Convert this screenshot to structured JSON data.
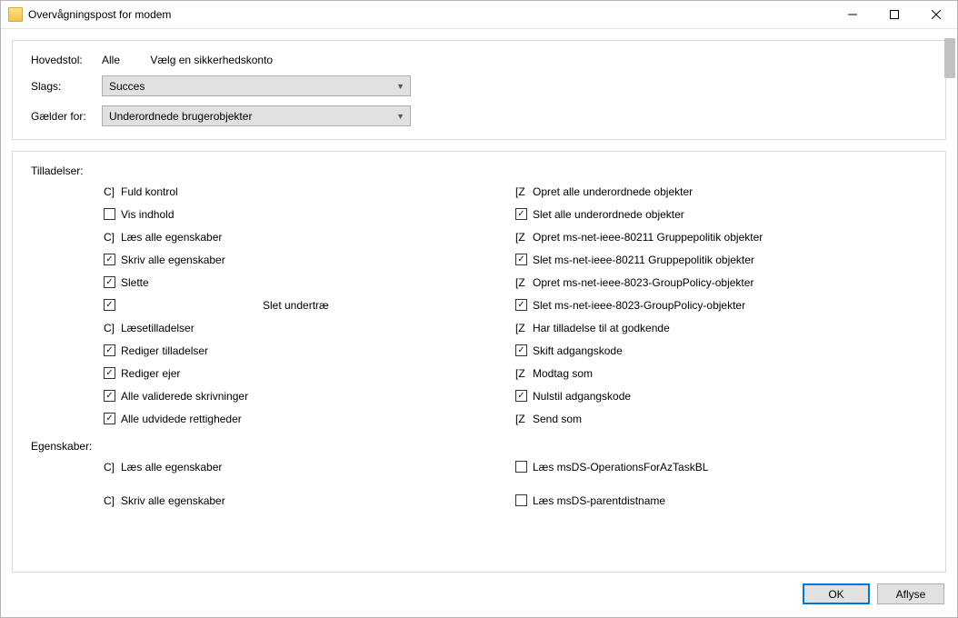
{
  "title": "Overvågningspost for modem",
  "header": {
    "hovedstol_label": "Hovedstol:",
    "hovedstol_value": "Alle",
    "choose_account": "Vælg en sikkerhedskonto",
    "slags_label": "Slags:",
    "slags_value": "Succes",
    "gaelder_label": "Gælder for:",
    "gaelder_value": "Underordnede brugerobjekter"
  },
  "permissions_label": "Tilladelser:",
  "properties_label": "Egenskaber:",
  "perm_left": [
    {
      "style": "C]",
      "label": "Fuld kontrol"
    },
    {
      "style": "box",
      "checked": false,
      "label": "Vis indhold"
    },
    {
      "style": "C]",
      "label": "Læs alle egenskaber"
    },
    {
      "style": "box",
      "checked": true,
      "label": "Skriv alle egenskaber"
    },
    {
      "style": "box",
      "checked": true,
      "label": "Slette"
    },
    {
      "style": "box",
      "checked": true,
      "label": "",
      "trailing": "Slet undertræ"
    },
    {
      "style": "C]",
      "label": "Læsetilladelser"
    },
    {
      "style": "box",
      "checked": true,
      "label": "Rediger tilladelser"
    },
    {
      "style": "box",
      "checked": true,
      "label": "Rediger ejer"
    },
    {
      "style": "box",
      "checked": true,
      "label": "Alle validerede skrivninger"
    },
    {
      "style": "box",
      "checked": true,
      "label": "Alle udvidede rettigheder"
    }
  ],
  "perm_right": [
    {
      "style": "[Z",
      "label": "Opret alle underordnede objekter"
    },
    {
      "style": "box",
      "checked": true,
      "label": "Slet alle underordnede objekter"
    },
    {
      "style": "[Z",
      "label": "Opret ms-net-ieee-80211 Gruppepolitik objekter"
    },
    {
      "style": "box",
      "checked": true,
      "label": "Slet ms-net-ieee-80211 Gruppepolitik objekter"
    },
    {
      "style": "[Z",
      "label": "Opret ms-net-ieee-8023-GroupPolicy-objekter"
    },
    {
      "style": "box",
      "checked": true,
      "label": "Slet ms-net-ieee-8023-GroupPolicy-objekter"
    },
    {
      "style": "[Z",
      "label": "Har tilladelse til at godkende"
    },
    {
      "style": "box",
      "checked": true,
      "label": "Skift adgangskode"
    },
    {
      "style": "[Z",
      "label": "Modtag som"
    },
    {
      "style": "box",
      "checked": true,
      "label": "Nulstil adgangskode"
    },
    {
      "style": "[Z",
      "label": "Send som"
    }
  ],
  "prop_left": [
    {
      "style": "C]",
      "label": "Læs alle egenskaber"
    },
    {
      "style": "C]",
      "label": "Skriv alle egenskaber"
    }
  ],
  "prop_right": [
    {
      "style": "box",
      "checked": false,
      "label": "Læs msDS-OperationsForAzTaskBL"
    },
    {
      "style": "box",
      "checked": false,
      "label": "Læs msDS-parentdistname"
    }
  ],
  "buttons": {
    "ok": "OK",
    "cancel": "Aflyse"
  }
}
